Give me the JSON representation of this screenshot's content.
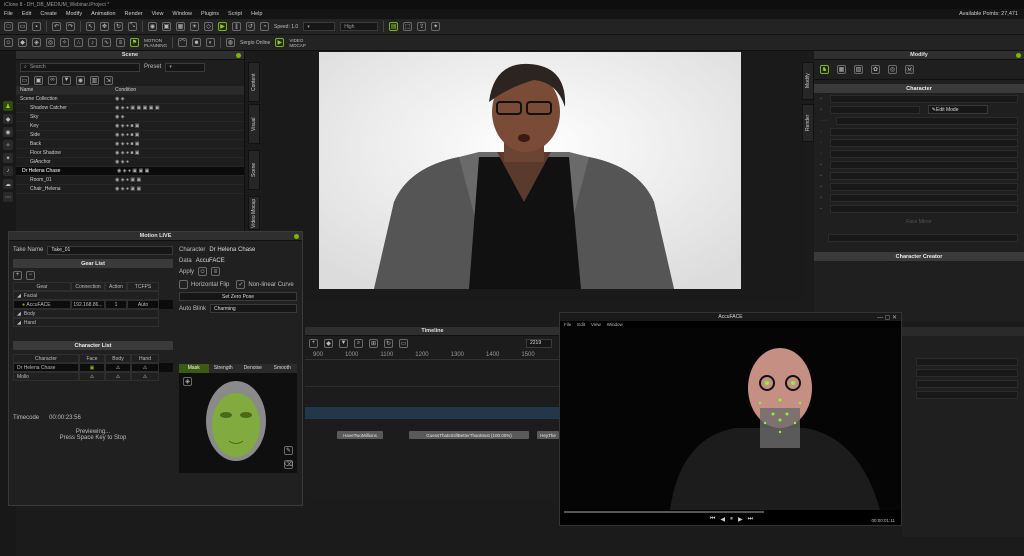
{
  "app": {
    "title": "iClone 8 - DH_DB_MEDIUM_Webinar.iProject *"
  },
  "menu": [
    "File",
    "Edit",
    "Create",
    "Modify",
    "Animation",
    "Render",
    "View",
    "Window",
    "Plugins",
    "Script",
    "Help"
  ],
  "status": {
    "points": "Available Points: 27,471"
  },
  "toolbar": {
    "speed": "Speed: 1.0",
    "quality": "High",
    "motion_planning": "MOTION\nPLANNING",
    "sergio": "Sergio Online",
    "video_mocap": "VIDEO\nMOCAP"
  },
  "scene": {
    "title": "Scene",
    "search_placeholder": "Search",
    "preset_label": "Preset",
    "col_name": "Name",
    "col_condition": "Condition",
    "items": [
      "Scene Collection",
      "Shadow Catcher",
      "Sky",
      "Key",
      "Side",
      "Back",
      "Floor Shadow",
      "GiAnchor",
      "Dr Helena Chase",
      "Room_01",
      "Chair_Helena"
    ]
  },
  "side_tabs": {
    "content": "Content",
    "visual": "Visual",
    "scene": "Scene",
    "video": "Video Mocap"
  },
  "right_tabs": {
    "modify": "Modify",
    "render": "Render"
  },
  "modify": {
    "title": "Modify",
    "section": "Character",
    "edit_mode": "Edit Mode",
    "face_tools": "Face Mirror",
    "creator": "Character Creator"
  },
  "motion_live": {
    "title": "Motion LIVE",
    "take_label": "Take Name",
    "take_value": "Take_01",
    "gear_list": "Gear List",
    "gear_cols": [
      "Gear",
      "Connection",
      "Action",
      "TCFPS"
    ],
    "gear_rows": [
      {
        "gear": "Facial"
      },
      {
        "gear": "AccuFACE",
        "conn": "192.168.86...",
        "action": "1",
        "fps": "Auto"
      },
      {
        "gear": "Body"
      },
      {
        "gear": "Hand"
      }
    ],
    "char_list": "Character List",
    "char_cols": [
      "Character",
      "Face",
      "Body",
      "Hand"
    ],
    "chars": [
      "Dr Helena Chase",
      "Mollo"
    ],
    "timecode_label": "Timecode",
    "timecode": "00:00:23:56",
    "preview": "Previewing...",
    "press": "Press Space Key to Stop",
    "character_label": "Character",
    "character": "Dr Helena Chase",
    "data_label": "Data",
    "data": "AccuFACE",
    "apply_label": "Apply",
    "hflip": "Horizontal Flip",
    "nonlinear": "Non-linear Curve",
    "zero_pose": "Set Zero Pose",
    "autoblink_label": "Auto Blink",
    "autoblink": "Charming",
    "tabs": [
      "Mask",
      "Strength",
      "Denoise",
      "Smooth"
    ]
  },
  "timeline": {
    "title": "Timeline",
    "frame": "2219",
    "ticks": [
      "900",
      "1000",
      "1100",
      "1200",
      "1300",
      "1400",
      "1500"
    ],
    "clips": [
      "HaveTwoMillions",
      "GuessThatsStillBetterThanMost (100.00%)",
      "HeyThe"
    ]
  },
  "accuface": {
    "title": "AccuFACE",
    "menu": [
      "File",
      "Edit",
      "View",
      "Window"
    ],
    "time": "00:00:01:11"
  },
  "colors": {
    "accent": "#7ab800",
    "panel": "#1f1f1f"
  }
}
